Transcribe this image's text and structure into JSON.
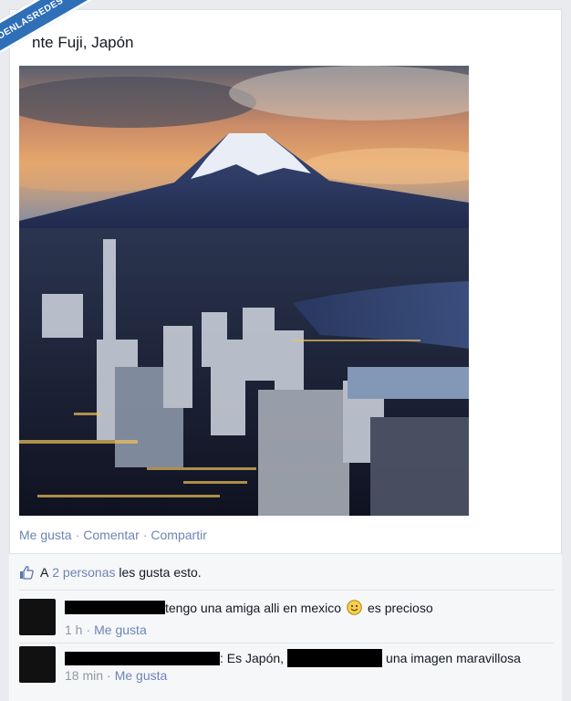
{
  "post": {
    "title": "nte Fuji, Japón"
  },
  "actions": {
    "like": "Me gusta",
    "comment": "Comentar",
    "share": "Compartir",
    "separator": "·"
  },
  "likes": {
    "prefix": "A",
    "link": "2 personas",
    "suffix": "les gusta esto."
  },
  "comments": [
    {
      "text_a": "tengo una amiga alli en mexico",
      "text_b": "es precioso",
      "time": "1 h",
      "like": "Me gusta"
    },
    {
      "text_a": ": Es Japón,",
      "text_b": "una imagen maravillosa",
      "time": "18 min",
      "like": "Me gusta"
    }
  ],
  "watermark": {
    "text": "VISTOENLASREDES"
  },
  "colors": {
    "link": "#6d84b4",
    "watermark": "#2f6fb7"
  }
}
